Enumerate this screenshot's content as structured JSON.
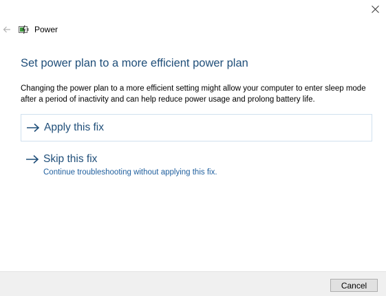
{
  "window": {
    "title": "Power",
    "close_icon": "close-icon",
    "back_icon": "back-arrow-icon",
    "app_icon": "power-battery-icon"
  },
  "main": {
    "heading": "Set power plan to a more efficient power plan",
    "description": "Changing the power plan to a more efficient setting might allow your computer to enter sleep mode after a period of inactivity and can help reduce power usage and prolong battery life.",
    "options": [
      {
        "label": "Apply this fix",
        "icon": "arrow-right-icon"
      },
      {
        "label": "Skip this fix",
        "description": "Continue troubleshooting without applying this fix.",
        "icon": "arrow-right-icon"
      }
    ]
  },
  "footer": {
    "cancel_label": "Cancel"
  },
  "colors": {
    "heading": "#1f4e79",
    "link_text": "#1f5f9e",
    "option_border": "#cfe0ee",
    "footer_bg": "#f0f0f0"
  }
}
